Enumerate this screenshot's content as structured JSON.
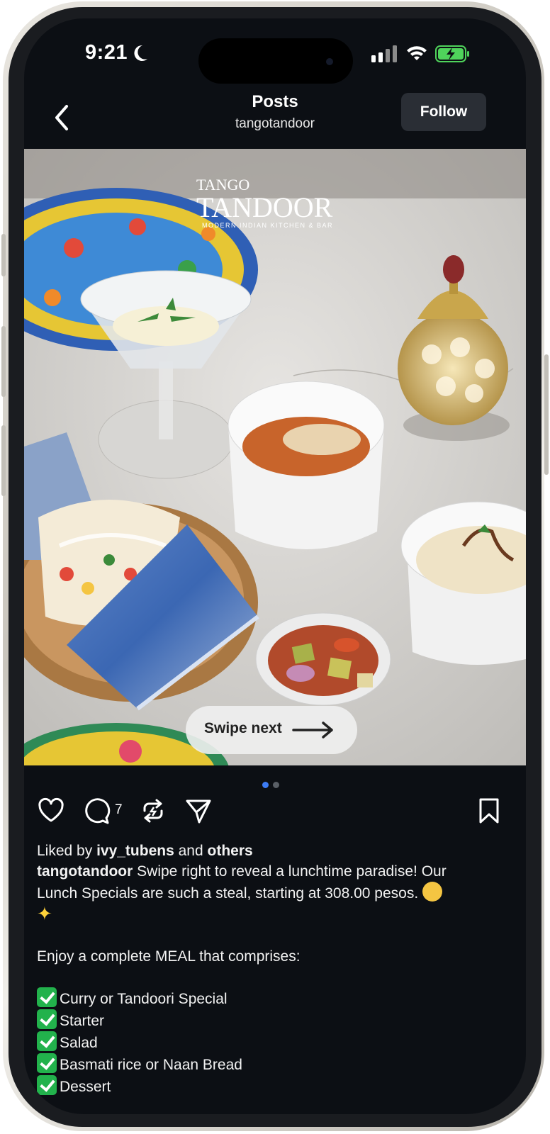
{
  "status_bar": {
    "time": "9:21"
  },
  "header": {
    "title": "Posts",
    "username": "tangotandoor",
    "follow_label": "Follow"
  },
  "photo": {
    "brand_top": "TANGO",
    "brand_main": "TANDOOR",
    "brand_tagline": "MODERN INDIAN KITCHEN & BAR",
    "swipe_label": "Swipe next"
  },
  "carousel": {
    "pages": 2,
    "current": 1,
    "active_color": "#3d7cf5",
    "inactive_color": "#5a5f66"
  },
  "actions": {
    "comments_count": "7"
  },
  "caption": {
    "liked_prefix": "Liked by",
    "liked_user": "ivy_tubens",
    "liked_and": "and",
    "liked_others": "others",
    "author": "tangotandoor",
    "text_1": "Swipe right to reveal a lunchtime paradise! Our",
    "text_2": "Lunch Specials are such a steal, starting at 308.00 pesos.",
    "intro": "Enjoy a complete MEAL that comprises:",
    "items": [
      "Curry or Tandoori Special",
      "Starter",
      "Salad",
      "Basmati rice or Naan Bread",
      "Dessert"
    ]
  },
  "icons": [
    "back-chevron-icon",
    "heart-icon",
    "comment-icon",
    "repost-icon",
    "share-icon",
    "bookmark-icon",
    "moon-icon",
    "signal-icon",
    "wifi-icon",
    "battery-icon",
    "arrow-right-icon"
  ]
}
